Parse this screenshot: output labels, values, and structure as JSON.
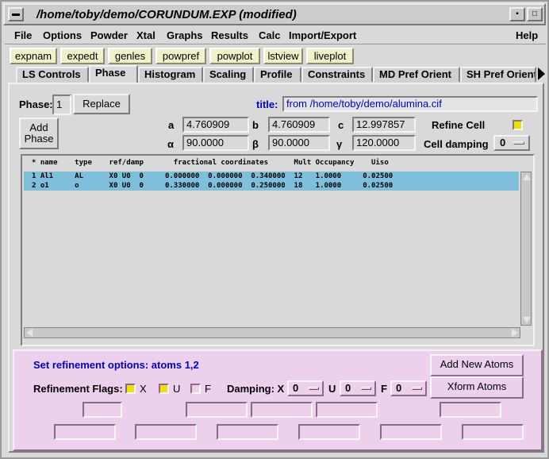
{
  "window": {
    "title": "/home/toby/demo/CORUNDUM.EXP (modified)"
  },
  "menubar": {
    "items": [
      "File",
      "Options",
      "Powder",
      "Xtal",
      "Graphs",
      "Results",
      "Calc",
      "Import/Export"
    ],
    "help": "Help"
  },
  "toolbar": {
    "buttons": [
      "expnam",
      "expedt",
      "genles",
      "powpref",
      "powplot",
      "lstview",
      "liveplot"
    ]
  },
  "tabs": [
    "LS Controls",
    "Phase",
    "Histogram",
    "Scaling",
    "Profile",
    "Constraints",
    "MD Pref Orient",
    "SH Pref Orient"
  ],
  "active_tab": "Phase",
  "phase": {
    "label": "Phase:",
    "number": "1",
    "replace": "Replace",
    "add_phase": [
      "Add",
      "Phase"
    ],
    "title_label": "title:",
    "title_value": "from /home/toby/demo/alumina.cif",
    "cell": {
      "a_label": "a",
      "a": "4.760909",
      "b_label": "b",
      "b": "4.760909",
      "c_label": "c",
      "c": "12.997857",
      "alpha_label": "α",
      "alpha": "90.0000",
      "beta_label": "β",
      "beta": "90.0000",
      "gamma_label": "γ",
      "gamma": "120.0000"
    },
    "refine_cell_label": "Refine Cell",
    "refine_cell": true,
    "cell_damping_label": "Cell damping",
    "cell_damping": "0"
  },
  "atoms": {
    "header": "* name    type    ref/damp       fractional coordinates      Mult Occupancy    Uiso",
    "rows": [
      "1 Al1     AL      X0 U0  0     0.000000  0.000000  0.340000  12   1.0000     0.02500",
      "2 o1      o       X0 U0  0     0.330000  0.000000  0.250000  18   1.0000     0.02500"
    ]
  },
  "refine_opts": {
    "heading": "Set refinement options: atoms 1,2",
    "flags_label": "Refinement Flags:",
    "x_label": "X",
    "x": true,
    "u_label": "U",
    "u": true,
    "f_label": "F",
    "f": false,
    "damping_label": "Damping: X",
    "damp_x": "0",
    "u_damp_label": "U",
    "damp_u": "0",
    "f_damp_label": "F",
    "damp_f": "0",
    "add_atoms": "Add New Atoms",
    "xform_atoms": "Xform Atoms"
  },
  "colors": {
    "accent": "#0000cc",
    "selected_row": "#7ec0dc",
    "bottom_panel": "#ecd0ec",
    "toolbar_btn": "#f2f0c8",
    "check_on": "#f0e000"
  }
}
